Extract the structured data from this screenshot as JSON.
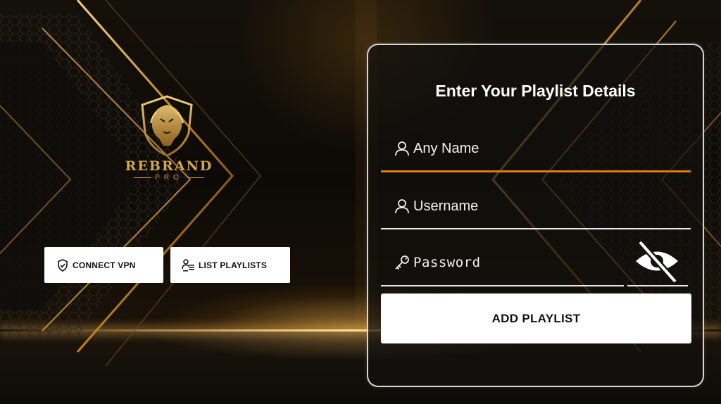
{
  "brand": {
    "name": "REBRAND",
    "sub": "PRO",
    "logo_icon": "lion-shield-icon"
  },
  "sidebar": {
    "connect_vpn": {
      "label": "CONNECT VPN",
      "icon": "shield-check-icon"
    },
    "list_playlists": {
      "label": "LIST PLAYLISTS",
      "icon": "user-list-icon"
    }
  },
  "form": {
    "title": "Enter Your Playlist Details",
    "name_field": {
      "placeholder": "Any Name",
      "icon": "user-icon"
    },
    "username_field": {
      "placeholder": "Username",
      "icon": "user-icon"
    },
    "password_field": {
      "placeholder": "Password",
      "icon": "key-icon"
    },
    "visibility_toggle": {
      "icon": "eye-off-icon"
    },
    "submit_label": "ADD PLAYLIST"
  },
  "colors": {
    "accent_orange": "#e07a18",
    "gold": "#d4a84a",
    "card_border": "#ebebeb",
    "button_bg": "#ffffff"
  }
}
